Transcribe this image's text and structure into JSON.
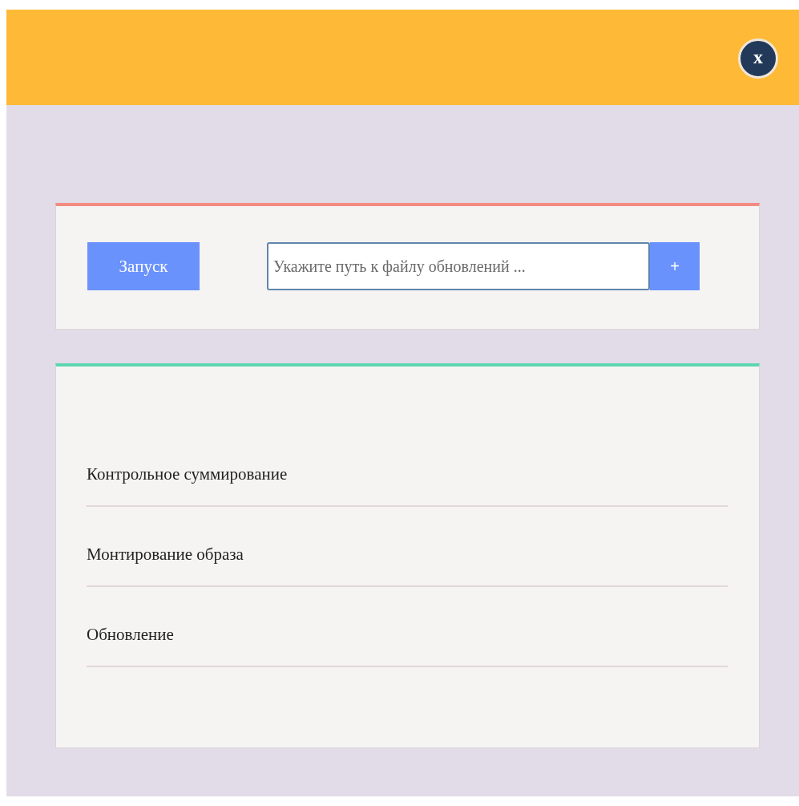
{
  "header": {
    "close_button": "x"
  },
  "launch_panel": {
    "launch_button": "Запуск",
    "path_field": {
      "placeholder": "Укажите путь к файлу обновлений ..."
    },
    "add_button": "+"
  },
  "operations": [
    {
      "label": "Контрольное суммирование"
    },
    {
      "label": "Монтирование образа"
    },
    {
      "label": "Обновление"
    }
  ]
}
